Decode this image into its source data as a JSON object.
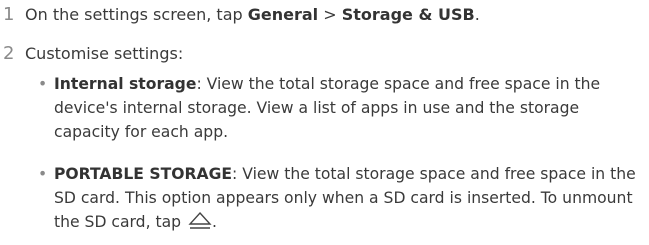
{
  "steps": [
    {
      "num": "1",
      "prefix": "On the settings screen, tap ",
      "bold1": "General",
      "sep": " > ",
      "bold2": "Storage & USB",
      "suffix": "."
    },
    {
      "num": "2",
      "text": "Customise settings:"
    }
  ],
  "bullets": [
    {
      "marker": "•",
      "title": "Internal storage",
      "desc": ": View the total storage space and free space in the device's internal storage. View a list of apps in use and the storage capacity for each app."
    },
    {
      "marker": "•",
      "title": "PORTABLE STORAGE",
      "desc": ": View the total storage space and free space in the SD card. This option appears only when a SD card is inserted. To unmount the SD card, tap ",
      "end_icon": "eject-icon",
      "suffix": "."
    }
  ]
}
